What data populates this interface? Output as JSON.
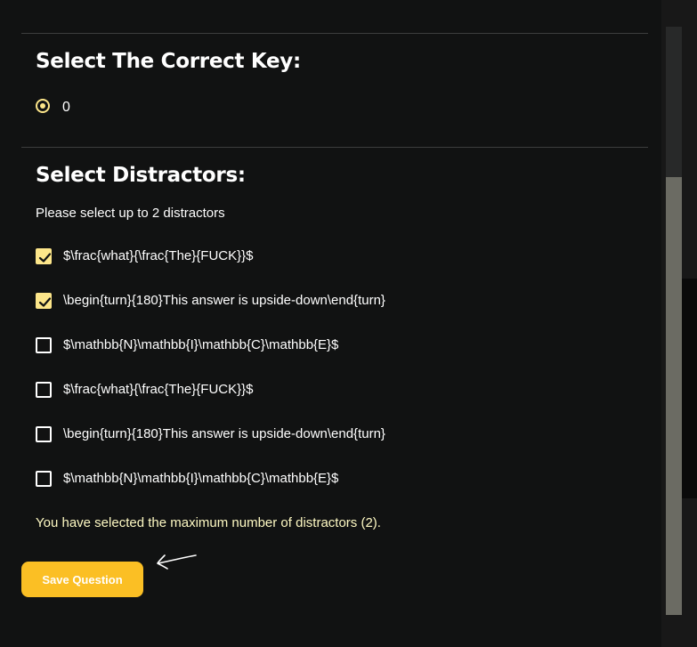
{
  "correct_key": {
    "heading": "Select The Correct Key:",
    "options": [
      {
        "label": "0",
        "selected": true
      }
    ]
  },
  "distractors": {
    "heading": "Select Distractors:",
    "helper": "Please select up to 2 distractors",
    "options": [
      {
        "label": "$\\frac{what}{\\frac{The}{FUCK}}$",
        "checked": true
      },
      {
        "label": "\\begin{turn}{180}This answer is upside-down\\end{turn}",
        "checked": true
      },
      {
        "label": "$\\mathbb{N}\\mathbb{I}\\mathbb{C}\\mathbb{E}$",
        "checked": false
      },
      {
        "label": "$\\frac{what}{\\frac{The}{FUCK}}$",
        "checked": false
      },
      {
        "label": "\\begin{turn}{180}This answer is upside-down\\end{turn}",
        "checked": false
      },
      {
        "label": "$\\mathbb{N}\\mathbb{I}\\mathbb{C}\\mathbb{E}$",
        "checked": false
      }
    ],
    "max_message": "You have selected the maximum number of distractors (2)."
  },
  "actions": {
    "save_label": "Save Question"
  },
  "colors": {
    "accent": "#fbbf24",
    "check": "#fde68a",
    "background": "#111212"
  }
}
